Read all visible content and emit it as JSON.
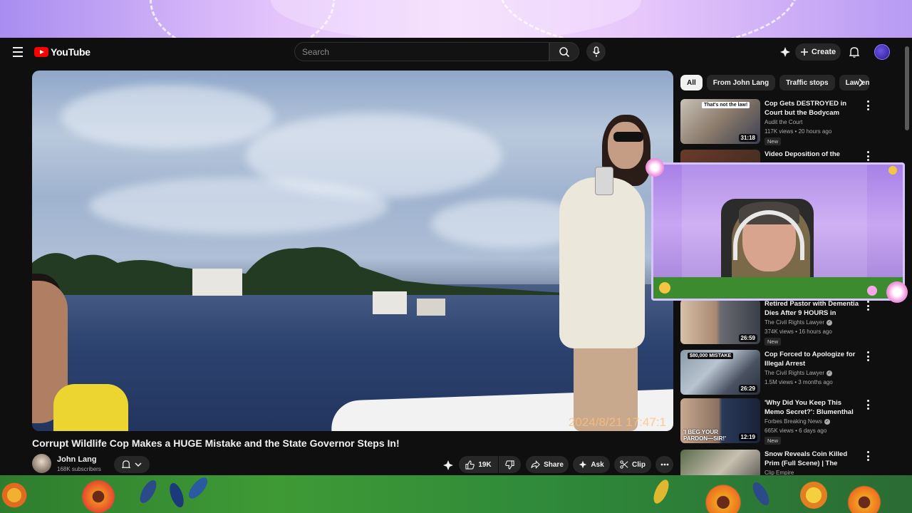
{
  "masthead": {
    "logo_text": "YouTube",
    "search_placeholder": "Search",
    "create_label": "Create"
  },
  "video": {
    "title": "Corrupt Wildlife Cop Makes a HUGE Mistake and the State Governor Steps In!",
    "burned_timestamp": "2024/8/21  17:47:1"
  },
  "channel": {
    "name": "John Lang",
    "subscribers": "168K subscribers"
  },
  "actions": {
    "likes": "19K",
    "share": "Share",
    "ask": "Ask",
    "clip": "Clip"
  },
  "chips": [
    "All",
    "From John Lang",
    "Traffic stops",
    "Law en"
  ],
  "recommendations": [
    {
      "title": "Cop Gets DESTROYED in Court but the Bodycam BACKFIRES",
      "channel": "Audit the Court",
      "verified": false,
      "meta": "117K views • 20 hours ago",
      "badge": "New",
      "duration": "31:18",
      "thumb_text": "That's not the law!"
    },
    {
      "title": "Video Deposition of the",
      "channel": "",
      "verified": false,
      "meta": "",
      "badge": "",
      "duration": "",
      "thumb_text": ""
    },
    {
      "title": "Retired Pastor with Dementia Dies After 9 HOURS in Restrai...",
      "channel": "The Civil Rights Lawyer",
      "verified": true,
      "meta": "374K views • 16 hours ago",
      "badge": "New",
      "duration": "26:59",
      "thumb_text": ""
    },
    {
      "title": "Cop Forced to Apologize for Illegal Arrest",
      "channel": "The Civil Rights Lawyer",
      "verified": true,
      "meta": "1.5M views • 3 months ago",
      "badge": "",
      "duration": "26:29",
      "thumb_text": "$80,000 MISTAKE"
    },
    {
      "title": "'Why Did You Keep This Memo Secret?': Blumenthal Grills ICE ...",
      "channel": "Forbes Breaking News",
      "verified": true,
      "meta": "665K views • 6 days ago",
      "badge": "New",
      "duration": "12:19",
      "thumb_text": "'I BEG YOUR PARDON—SIR!'"
    },
    {
      "title": "Snow Reveals Coin Killed Prim (Full Scene) | The Hunger ...",
      "channel": "Clip Empire",
      "verified": false,
      "meta": "",
      "badge": "",
      "duration": "",
      "thumb_text": ""
    }
  ],
  "colors": {
    "background": "#0f0f0f",
    "brand_red": "#ff0000",
    "surface": "#272727",
    "overlay_purple": "#c9a6f2",
    "overlay_green": "#3f9a35"
  },
  "icons": [
    "menu-icon",
    "youtube-logo",
    "search-icon",
    "mic-icon",
    "gemini-icon",
    "plus-icon",
    "bell-icon",
    "like-icon",
    "dislike-icon",
    "share-icon",
    "sparkle-icon",
    "scissors-icon",
    "more-icon",
    "chevron-right-icon",
    "kebab-icon",
    "verified-icon"
  ]
}
